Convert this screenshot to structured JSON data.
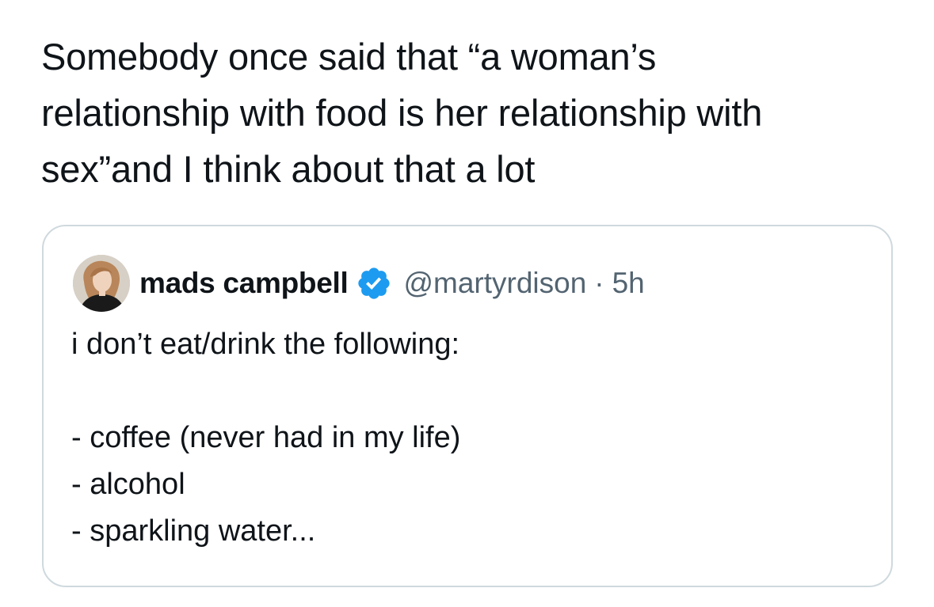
{
  "tweet": {
    "text_lines": [
      "Somebody once said that “a woman’s",
      "relationship with food is her relationship with",
      "sex”and I think about that a lot"
    ]
  },
  "quoted_tweet": {
    "display_name": "mads campbell",
    "verified_icon": "verified-badge-icon",
    "handle": "@martyrdison",
    "separator": "·",
    "timestamp": "5h",
    "body_lines": [
      "i don’t eat/drink the following:",
      "",
      "- coffee (never had in my life)",
      "- alcohol",
      "- sparkling water..."
    ]
  },
  "colors": {
    "text_primary": "#0f1419",
    "text_secondary": "#536471",
    "verified_blue": "#1d9bf0",
    "card_border": "#cfd9de"
  }
}
